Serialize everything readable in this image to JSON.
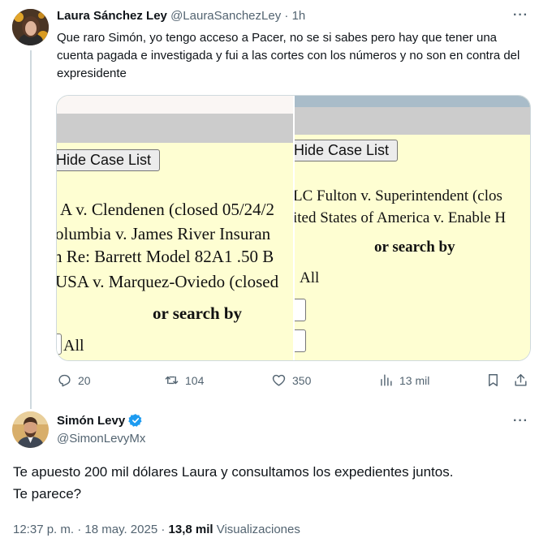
{
  "parent_tweet": {
    "display_name": "Laura Sánchez Ley",
    "handle": "@LauraSanchezLey",
    "separator": "·",
    "time_ago": "1h",
    "text": "Que raro Simón, yo tengo acceso a Pacer, no se si sabes pero hay que tener una cuenta pagada e investigada y fui a las cortes con los números y no son en contra del expresidente",
    "media": {
      "left_panel": {
        "button_label": "Hide Case List",
        "case_lines": [
          "A v. Clendenen (closed 05/24/2",
          "olumbia v. James River Insuran",
          "n Re: Barrett Model 82A1 .50 B",
          "USA v. Marquez-Oviedo (closed"
        ],
        "search_label": "or search by",
        "all_label": "All"
      },
      "right_panel": {
        "button_label": "Hide Case List",
        "case_lines": [
          "LC Fulton v. Superintendent (clos",
          "ited States of America v. Enable H"
        ],
        "search_label": "or search by",
        "all_label": "All"
      }
    },
    "actions": {
      "replies": "20",
      "reposts": "104",
      "likes": "350",
      "views": "13 mil"
    }
  },
  "main_tweet": {
    "display_name": "Simón Levy",
    "handle": "@SimonLevyMx",
    "verified": true,
    "text_line1": "Te apuesto 200 mil dólares Laura y consultamos los expedientes juntos.",
    "text_line2": "Te parece?",
    "time": "12:37 p. m.",
    "dot1": "·",
    "date": "18 may. 2025",
    "dot2": "·",
    "views_count": "13,8 mil",
    "views_label": "Visualizaciones"
  },
  "colors": {
    "text_primary": "#0f1419",
    "text_secondary": "#536471",
    "verified_blue": "#1d9bf0",
    "document_background": "#fefed2"
  },
  "icons": [
    "more-icon",
    "reply-icon",
    "repost-icon",
    "like-icon",
    "views-icon",
    "bookmark-icon",
    "share-icon",
    "verified-badge-icon"
  ]
}
